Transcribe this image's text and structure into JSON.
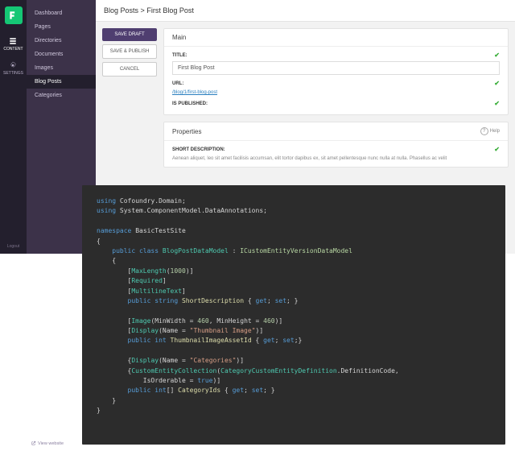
{
  "rail": {
    "items": [
      {
        "label": "CONTENT"
      },
      {
        "label": "SETTINGS"
      }
    ],
    "logout": "Logout"
  },
  "view_website": "View website",
  "sidebar": {
    "items": [
      {
        "label": "Dashboard"
      },
      {
        "label": "Pages"
      },
      {
        "label": "Directories"
      },
      {
        "label": "Documents"
      },
      {
        "label": "Images"
      },
      {
        "label": "Blog Posts"
      },
      {
        "label": "Categories"
      }
    ]
  },
  "breadcrumb": {
    "parent": "Blog Posts",
    "sep": ">",
    "current": "First Blog Post"
  },
  "actions": {
    "save_draft": "SAVE DRAFT",
    "save_publish": "SAVE & PUBLISH",
    "cancel": "CANCEL"
  },
  "main_panel": {
    "title": "Main",
    "title_label": "TITLE:",
    "title_value": "First Blog Post",
    "url_label": "URL:",
    "url_value": "/blog/1/first-blog-post",
    "published_label": "IS PUBLISHED:"
  },
  "props_panel": {
    "title": "Properties",
    "help": "Help",
    "short_desc_label": "SHORT DESCRIPTION:",
    "short_desc_value": "Aenean aliquet, leo sit amet facilisis accumsan, elit tortor dapibus ex, sit amet pellentesque nunc nulla at nulla. Phasellus ac velit"
  },
  "code": {
    "using1_kw": "using",
    "using1_ns": "Cofoundry.Domain;",
    "using2_kw": "using",
    "using2_ns": "System.ComponentModel.DataAnnotations;",
    "ns_kw": "namespace",
    "ns_name": "BasicTestSite",
    "class_mod": "public class",
    "class_name": "BlogPostDataModel",
    "iface": "ICustomEntityVersionDataModel",
    "attr_maxlen": "MaxLength",
    "maxlen_val": "1000",
    "attr_req": "Required",
    "attr_multi": "MultilineText",
    "pub_str": "public string",
    "prop_short": "ShortDescription",
    "get": "get",
    "set": "set",
    "attr_img": "Image",
    "img_minw": "MinWidth = ",
    "img_minw_v": "460",
    "img_minh": ", MinHeight = ",
    "img_minh_v": "460",
    "attr_disp": "Display",
    "disp_name": "Name = ",
    "disp_thumb": "\"Thumbnail Image\"",
    "pub_int": "public int",
    "prop_thumb": "ThumbnailImageAssetId",
    "disp_cat": "\"Categories\"",
    "attr_coll": "CustomEntityCollection",
    "coll_def": "CategoryCustomEntityDefinition",
    "coll_defcode": ".DefinitionCode,",
    "coll_ord": "IsOrderable = ",
    "true": "true",
    "pub_intarr": "public int",
    "arr": "[]",
    "prop_catids": "CategoryIds"
  }
}
